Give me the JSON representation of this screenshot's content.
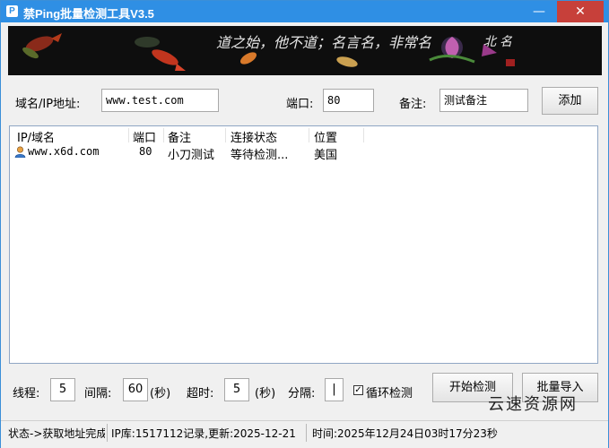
{
  "window": {
    "title": "禁Ping批量检测工具V3.5",
    "app_icon_glyph": "P",
    "minimize_glyph": "—",
    "close_glyph": "✕",
    "accent_color": "#2f8fe4"
  },
  "banner": {
    "calligraphy": "道之始，他不道；名言名，非常名"
  },
  "form": {
    "host_label": "域名/IP地址:",
    "host_value": "www.test.com",
    "port_label": "端口:",
    "port_value": "80",
    "note_label": "备注:",
    "note_value": "测试备注",
    "add_label": "添加"
  },
  "list": {
    "columns": [
      "IP/域名",
      "端口",
      "备注",
      "连接状态",
      "位置"
    ],
    "rows": [
      {
        "host": "www.x6d.com",
        "port": "80",
        "note": "小刀测试",
        "status": "等待检测...",
        "location": "美国",
        "icon": "user-icon"
      }
    ]
  },
  "controls": {
    "threads_label": "线程:",
    "threads_value": "5",
    "interval_label": "间隔:",
    "interval_value": "60",
    "interval_unit": "(秒)",
    "timeout_label": "超时:",
    "timeout_value": "5",
    "timeout_unit": "(秒)",
    "split_label": "分隔:",
    "split_value": "|",
    "loop_label": "循环检测",
    "loop_checked": true,
    "start_label": "开始检测",
    "import_label": "批量导入"
  },
  "status": {
    "state": "状态->获取地址完成",
    "ipdb": "IP库:1517112记录,更新:2025-12-21",
    "time": "时间:2025年12月24日03时17分23秒"
  },
  "watermark": "云速资源网"
}
